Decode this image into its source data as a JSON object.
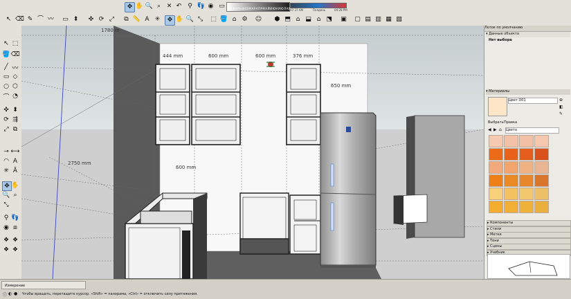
{
  "toolbar": {
    "shadow_label": "ЯНВАРЬФЕВМАРАПРМАЙИЮНИЮЛАВГСЕНОКТНОЯДЕК",
    "time_start": "07:37 AM",
    "time_mid": "Полдень",
    "time_end": "04:28 PM"
  },
  "viewport": {
    "dims": {
      "d444": "444 mm",
      "d600a": "600 mm",
      "d600b": "600 mm",
      "d376": "376 mm",
      "d650": "650 mm",
      "d600v": "600 mm",
      "d2750": "2750 mm",
      "d1780": "1780 m"
    }
  },
  "panel": {
    "tray_title": "Лоток по умолчанию",
    "entity_title": "Данные объекта",
    "entity_value": "Нет выбора",
    "materials_title": "Материалы",
    "material_name": "Цвет D01",
    "tab_select": "Выбрать",
    "tab_edit": "Правка",
    "library": "Цвета",
    "sections": [
      "Компоненты",
      "Стили",
      "Метки",
      "Тени",
      "Сцены",
      "Учебник"
    ]
  },
  "swatch_colors": [
    "#f6c9b1",
    "#f3c2a6",
    "#f2c0a4",
    "#f5c7af",
    "#ed6b18",
    "#ea6219",
    "#e45d1d",
    "#d8501a",
    "#f2a97b",
    "#f1a56d",
    "#f0b283",
    "#e9b492",
    "#ee7f17",
    "#ea8a25",
    "#e7862c",
    "#d9762b",
    "#f7d07a",
    "#f3c15f",
    "#f1c86b",
    "#eec067",
    "#f4ad2f",
    "#f1b035",
    "#eeb23a",
    "#e9b03d"
  ],
  "status": {
    "measure_label": "Измерение",
    "hint": "Чтобы вращать, перетащите курсор. «Shift» = панорама, «Ctrl» = отключить силу притяжения."
  }
}
